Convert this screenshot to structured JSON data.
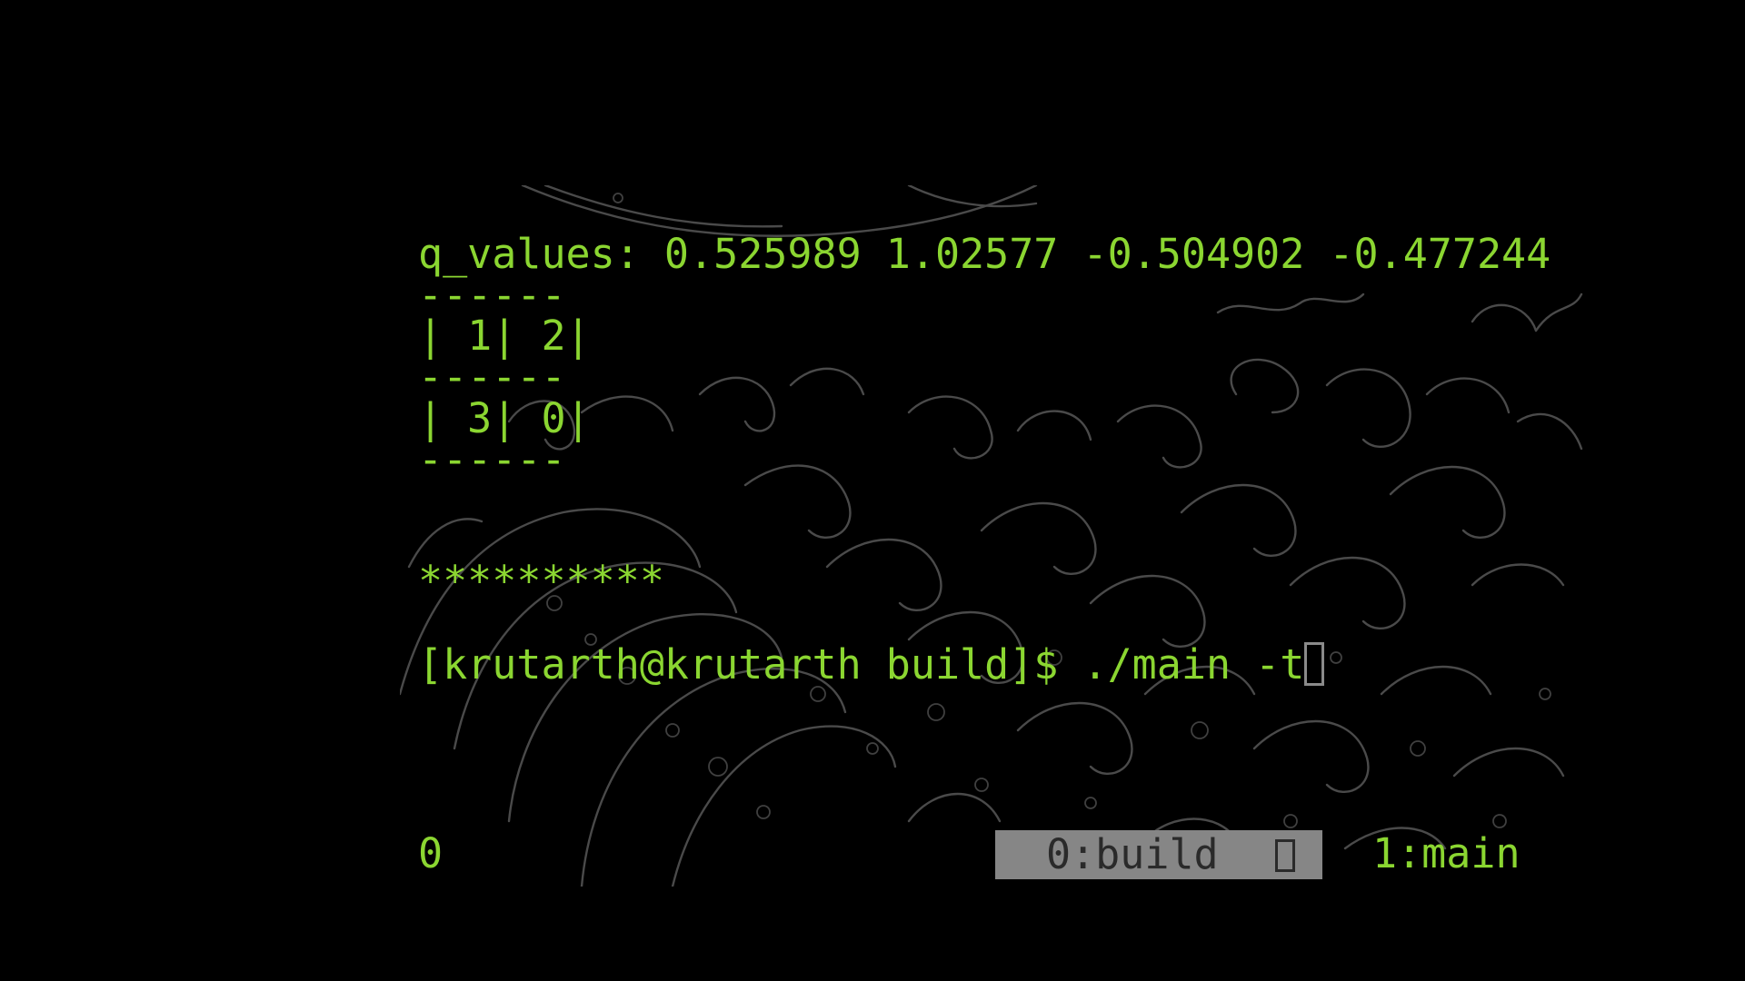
{
  "terminal": {
    "q_values_line": "q_values: 0.525989 1.02577 -0.504902 -0.477244",
    "grid": {
      "border_top": "------",
      "row_1": "| 1| 2|",
      "border_middle": "------",
      "row_2": "| 3| 0|",
      "border_bottom": "------"
    },
    "separator": "**********",
    "prompt": "[krutarth@krutarth build]$ ./main -t"
  },
  "tmux_status": {
    "session": "0",
    "windows": [
      {
        "label": "0:build",
        "active": true
      },
      {
        "label": "1:main",
        "active": false
      }
    ]
  },
  "colors": {
    "text": "#8bd631",
    "background": "#000000",
    "active_window_bg": "#868686",
    "wave_lines": "#4a4a4a"
  }
}
